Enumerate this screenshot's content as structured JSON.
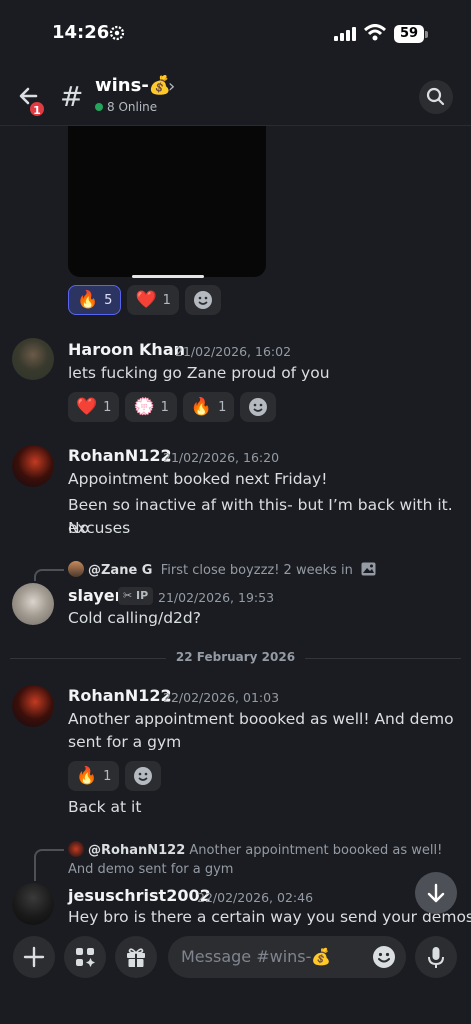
{
  "status_bar": {
    "time": "14:26",
    "battery": "59"
  },
  "header": {
    "unread_badge": "1",
    "channel_name": "wins-💰",
    "online": "8 Online"
  },
  "reactions_top": [
    {
      "emoji": "🔥",
      "count": "5"
    },
    {
      "emoji": "❤️",
      "count": "1"
    }
  ],
  "messages": [
    {
      "username": "Haroon Khan",
      "timestamp": "21/02/2026, 16:02",
      "text": "lets fucking go Zane proud of you",
      "reactions": [
        {
          "emoji": "❤️",
          "count": "1"
        },
        {
          "emoji": "💮",
          "count": "1"
        },
        {
          "emoji": "🔥",
          "count": "1"
        }
      ]
    },
    {
      "username": "RohanN122",
      "timestamp": "21/02/2026, 16:20",
      "text1": "Appointment booked next Friday!",
      "text2_line1": "Been so inactive af with this- but I’m back with it. No",
      "text2_line2": "excuses"
    },
    {
      "reply_user": "@Zane G",
      "reply_text": "First close boyzzz! 2 weeks in",
      "username": "slayer",
      "tag": "IP",
      "timestamp": "21/02/2026, 19:53",
      "text": "Cold calling/d2d?"
    }
  ],
  "date_divider": "22 February 2026",
  "messages2": [
    {
      "username": "RohanN122",
      "timestamp": "22/02/2026, 01:03",
      "text_line1": "Another appointment boooked as well! And demo",
      "text_line2": "sent for a gym",
      "reactions": [
        {
          "emoji": "🔥",
          "count": "1"
        }
      ],
      "followup": "Back at it"
    },
    {
      "reply_user": "@RohanN122",
      "reply_text_line1": "Another appointment boooked as well!",
      "reply_text_line2": "And demo sent for a gym",
      "username": "jesuschrist2002",
      "timestamp": "22/02/2026, 02:46",
      "text": "Hey bro is there a certain way you send your demos I"
    }
  ],
  "input": {
    "placeholder": "Message #wins-💰"
  }
}
